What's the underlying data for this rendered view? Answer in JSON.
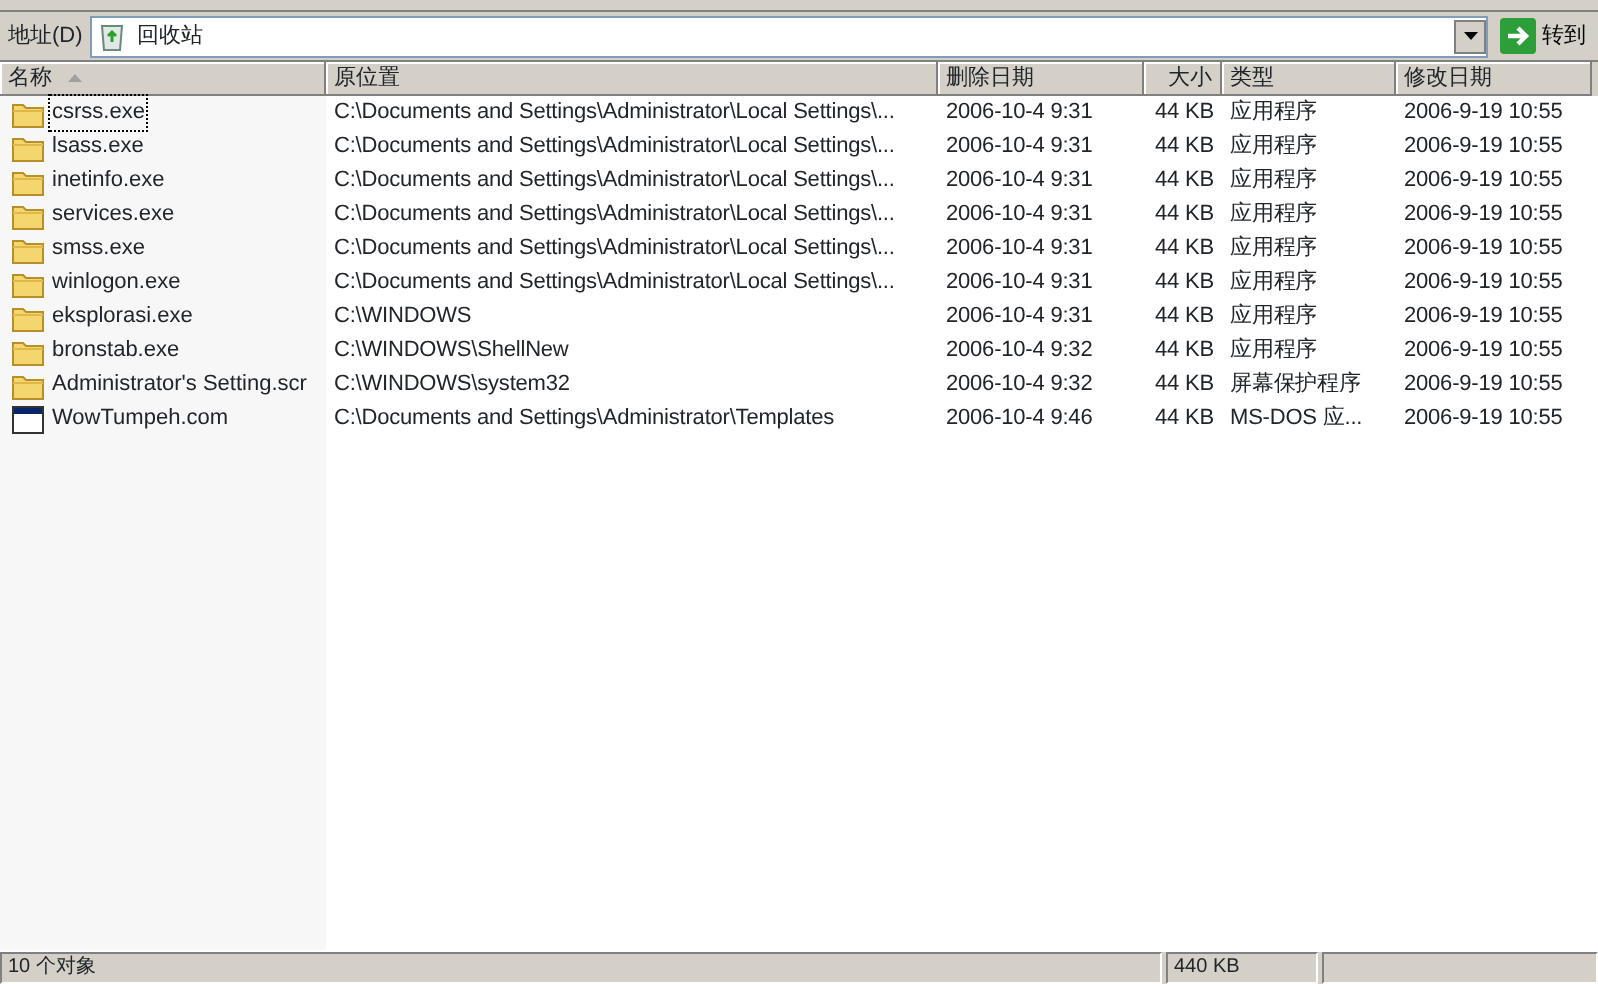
{
  "address_bar": {
    "label": "地址(D)",
    "value": "回收站",
    "go_button": "转到"
  },
  "columns": [
    {
      "label": "名称",
      "sorted": true
    },
    {
      "label": "原位置",
      "sorted": false
    },
    {
      "label": "删除日期",
      "sorted": false
    },
    {
      "label": "大小",
      "sorted": false
    },
    {
      "label": "类型",
      "sorted": false
    },
    {
      "label": "修改日期",
      "sorted": false
    }
  ],
  "rows": [
    {
      "kind": "folder",
      "focused": true,
      "cells": [
        "csrss.exe",
        "C:\\Documents and Settings\\Administrator\\Local Settings\\...",
        "2006-10-4 9:31",
        "44 KB",
        "应用程序",
        "2006-9-19 10:55"
      ]
    },
    {
      "kind": "folder",
      "focused": false,
      "cells": [
        "lsass.exe",
        "C:\\Documents and Settings\\Administrator\\Local Settings\\...",
        "2006-10-4 9:31",
        "44 KB",
        "应用程序",
        "2006-9-19 10:55"
      ]
    },
    {
      "kind": "folder",
      "focused": false,
      "cells": [
        "inetinfo.exe",
        "C:\\Documents and Settings\\Administrator\\Local Settings\\...",
        "2006-10-4 9:31",
        "44 KB",
        "应用程序",
        "2006-9-19 10:55"
      ]
    },
    {
      "kind": "folder",
      "focused": false,
      "cells": [
        "services.exe",
        "C:\\Documents and Settings\\Administrator\\Local Settings\\...",
        "2006-10-4 9:31",
        "44 KB",
        "应用程序",
        "2006-9-19 10:55"
      ]
    },
    {
      "kind": "folder",
      "focused": false,
      "cells": [
        "smss.exe",
        "C:\\Documents and Settings\\Administrator\\Local Settings\\...",
        "2006-10-4 9:31",
        "44 KB",
        "应用程序",
        "2006-9-19 10:55"
      ]
    },
    {
      "kind": "folder",
      "focused": false,
      "cells": [
        "winlogon.exe",
        "C:\\Documents and Settings\\Administrator\\Local Settings\\...",
        "2006-10-4 9:31",
        "44 KB",
        "应用程序",
        "2006-9-19 10:55"
      ]
    },
    {
      "kind": "folder",
      "focused": false,
      "cells": [
        "eksplorasi.exe",
        "C:\\WINDOWS",
        "2006-10-4 9:31",
        "44 KB",
        "应用程序",
        "2006-9-19 10:55"
      ]
    },
    {
      "kind": "folder",
      "focused": false,
      "cells": [
        "bronstab.exe",
        "C:\\WINDOWS\\ShellNew",
        "2006-10-4 9:32",
        "44 KB",
        "应用程序",
        "2006-9-19 10:55"
      ]
    },
    {
      "kind": "folder",
      "focused": false,
      "cells": [
        "Administrator's Setting.scr",
        "C:\\WINDOWS\\system32",
        "2006-10-4 9:32",
        "44 KB",
        "屏幕保护程序",
        "2006-9-19 10:55"
      ]
    },
    {
      "kind": "program",
      "focused": false,
      "cells": [
        "WowTumpeh.com",
        "C:\\Documents and Settings\\Administrator\\Templates",
        "2006-10-4 9:46",
        "44 KB",
        "MS-DOS 应...",
        "2006-9-19 10:55"
      ]
    }
  ],
  "status_bar": [
    "10 个对象",
    "440 KB"
  ]
}
